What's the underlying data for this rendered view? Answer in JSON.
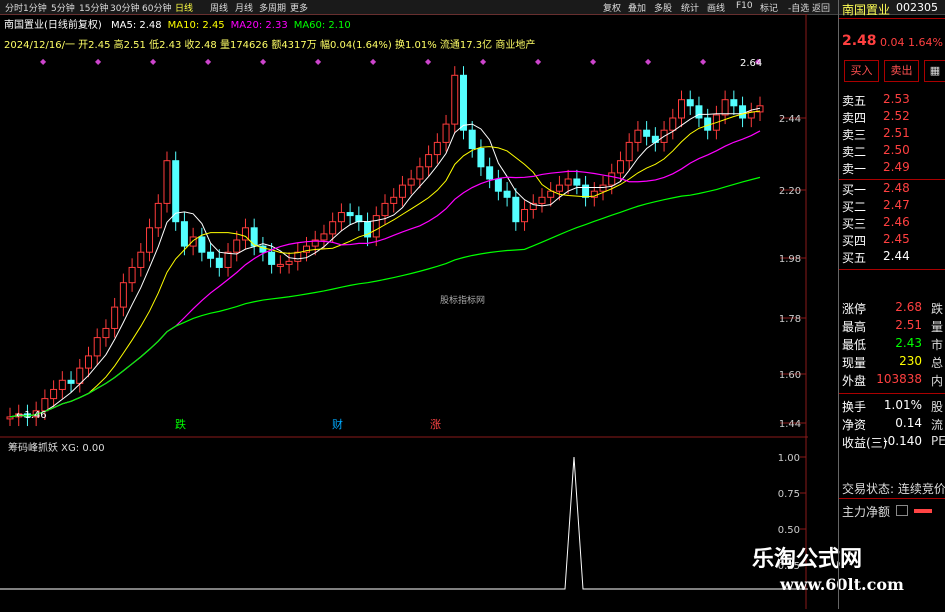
{
  "toolbar": {
    "tabs": [
      "分时",
      "1分钟",
      "5分钟",
      "15分钟",
      "30分钟",
      "60分钟",
      "日线",
      "周线",
      "月线",
      "多周期",
      "更多"
    ],
    "right_tabs": [
      "复权",
      "叠加",
      "多股",
      "统计",
      "画线",
      "F10",
      "标记",
      "-自选",
      "返回"
    ]
  },
  "header": {
    "title": "南国置业(日线前复权)",
    "ma": [
      {
        "label": "MA5:",
        "value": "2.48",
        "color": "#ffffff"
      },
      {
        "label": "MA10:",
        "value": "2.45",
        "color": "#ffff00"
      },
      {
        "label": "MA20:",
        "value": "2.33",
        "color": "#ff00ff"
      },
      {
        "label": "MA60:",
        "value": "2.10",
        "color": "#00ff00"
      }
    ],
    "info": "2024/12/16/一 开2.45 高2.51 低2.43 收2.48 量174626 额4317万 幅0.04(1.64%) 换1.01% 流通17.3亿 商业地产"
  },
  "price_axis": [
    "2.44",
    "2.20",
    "1.98",
    "1.78",
    "1.60",
    "1.44"
  ],
  "annotations": {
    "high_label": "2.64",
    "low_label": "1.46",
    "watermark": "股标指标网"
  },
  "markers": [
    {
      "text": "跌",
      "color": "#00ff00"
    },
    {
      "text": "财",
      "color": "#00aaff"
    },
    {
      "text": "涨",
      "color": "#ff4444"
    }
  ],
  "sub_chart": {
    "title": "筹码峰抓妖 XG: 0.00",
    "axis": [
      "1.00",
      "0.75",
      "0.50",
      "0.25"
    ]
  },
  "brand": {
    "name": "乐淘公式网",
    "url": "www.60lt.com"
  },
  "right_panel": {
    "stock_name": "南国置业",
    "code": "002305",
    "price": "2.48",
    "change": "0.04",
    "pct": "1.64%",
    "buy_btn": "买入",
    "sell_btn": "卖出",
    "asks": [
      {
        "label": "卖五",
        "price": "2.53"
      },
      {
        "label": "卖四",
        "price": "2.52"
      },
      {
        "label": "卖三",
        "price": "2.51"
      },
      {
        "label": "卖二",
        "price": "2.50"
      },
      {
        "label": "卖一",
        "price": "2.49"
      }
    ],
    "bids": [
      {
        "label": "买一",
        "price": "2.48"
      },
      {
        "label": "买二",
        "price": "2.47"
      },
      {
        "label": "买三",
        "price": "2.46"
      },
      {
        "label": "买四",
        "price": "2.45"
      },
      {
        "label": "买五",
        "price": "2.44"
      }
    ],
    "stats": [
      {
        "label": "涨停",
        "value": "2.68",
        "tail": "跌"
      },
      {
        "label": "最高",
        "value": "2.51",
        "tail": "量"
      },
      {
        "label": "最低",
        "value": "2.43",
        "tail": "市"
      },
      {
        "label": "现量",
        "value": "230",
        "tail": "总"
      },
      {
        "label": "外盘",
        "value": "103838",
        "tail": "内"
      },
      {
        "label": "换手",
        "value": "1.01%",
        "tail": "股"
      },
      {
        "label": "净资",
        "value": "0.14",
        "tail": "流"
      },
      {
        "label": "收益(三)",
        "value": "-0.140",
        "tail": "PE"
      }
    ],
    "trade_status": "交易状态: 连续竞价",
    "main_flow": "主力净额"
  }
}
